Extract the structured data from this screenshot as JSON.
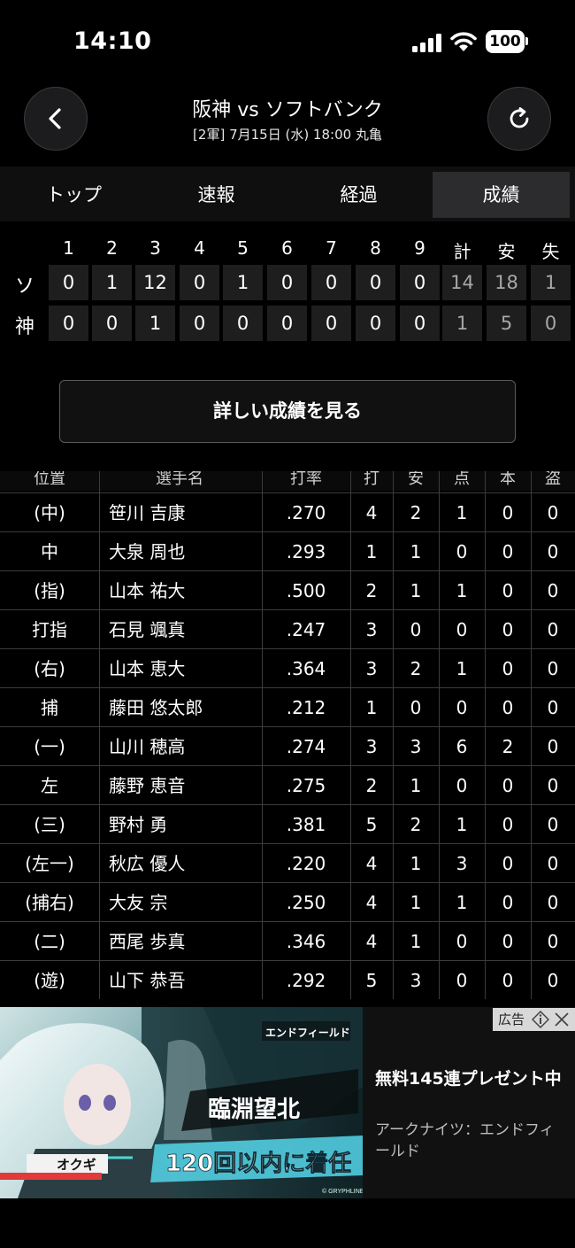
{
  "status_bar": {
    "time": "14:10",
    "battery": "100"
  },
  "header": {
    "title": "阪神 vs ソフトバンク",
    "subtitle": "[2軍] 7月15日 (水) 18:00 丸亀"
  },
  "tabs": [
    {
      "label": "トップ",
      "active": false
    },
    {
      "label": "速報",
      "active": false
    },
    {
      "label": "経過",
      "active": false
    },
    {
      "label": "成績",
      "active": true
    }
  ],
  "linescore": {
    "headers": [
      "1",
      "2",
      "3",
      "4",
      "5",
      "6",
      "7",
      "8",
      "9",
      "計",
      "安",
      "失"
    ],
    "teams": [
      {
        "label": "ソ",
        "scores": [
          "0",
          "1",
          "12",
          "0",
          "1",
          "0",
          "0",
          "0",
          "0",
          "14",
          "18",
          "1"
        ]
      },
      {
        "label": "神",
        "scores": [
          "0",
          "0",
          "1",
          "0",
          "0",
          "0",
          "0",
          "0",
          "0",
          "1",
          "5",
          "0"
        ]
      }
    ]
  },
  "detail_button": {
    "label": "詳しい成績を見る"
  },
  "batting": {
    "headers": [
      "位置",
      "選手名",
      "打率",
      "打",
      "安",
      "点",
      "本",
      "盗"
    ],
    "rows": [
      [
        "(中)",
        "笹川 吉康",
        ".270",
        "4",
        "2",
        "1",
        "0",
        "0"
      ],
      [
        "中",
        "大泉 周也",
        ".293",
        "1",
        "1",
        "0",
        "0",
        "0"
      ],
      [
        "(指)",
        "山本 祐大",
        ".500",
        "2",
        "1",
        "1",
        "0",
        "0"
      ],
      [
        "打指",
        "石見 颯真",
        ".247",
        "3",
        "0",
        "0",
        "0",
        "0"
      ],
      [
        "(右)",
        "山本 恵大",
        ".364",
        "3",
        "2",
        "1",
        "0",
        "0"
      ],
      [
        "捕",
        "藤田 悠太郎",
        ".212",
        "1",
        "0",
        "0",
        "0",
        "0"
      ],
      [
        "(一)",
        "山川 穂高",
        ".274",
        "3",
        "3",
        "6",
        "2",
        "0"
      ],
      [
        "左",
        "藤野 恵音",
        ".275",
        "2",
        "1",
        "0",
        "0",
        "0"
      ],
      [
        "(三)",
        "野村 勇",
        ".381",
        "5",
        "2",
        "1",
        "0",
        "0"
      ],
      [
        "(左一)",
        "秋広 優人",
        ".220",
        "4",
        "1",
        "3",
        "0",
        "0"
      ],
      [
        "(捕右)",
        "大友 宗",
        ".250",
        "4",
        "1",
        "1",
        "0",
        "0"
      ],
      [
        "(二)",
        "西尾 歩真",
        ".346",
        "4",
        "1",
        "0",
        "0",
        "0"
      ],
      [
        "(遊)",
        "山下 恭吾",
        ".292",
        "5",
        "3",
        "0",
        "0",
        "0"
      ]
    ]
  },
  "ad": {
    "badge": "広告",
    "headline": "無料145連プレゼント中",
    "advertiser": "アークナイツ：エンドフィールド",
    "image_text": {
      "logo": "エンドフィールド",
      "event": "臨淵望北",
      "tagline": "120回以内に着任",
      "name_tag": "オクギ",
      "copyright": "© GRYPHLINE"
    }
  },
  "colors": {
    "background": "#000000",
    "cell": "#1e1e1e",
    "active_tab": "#2c2c2e"
  }
}
